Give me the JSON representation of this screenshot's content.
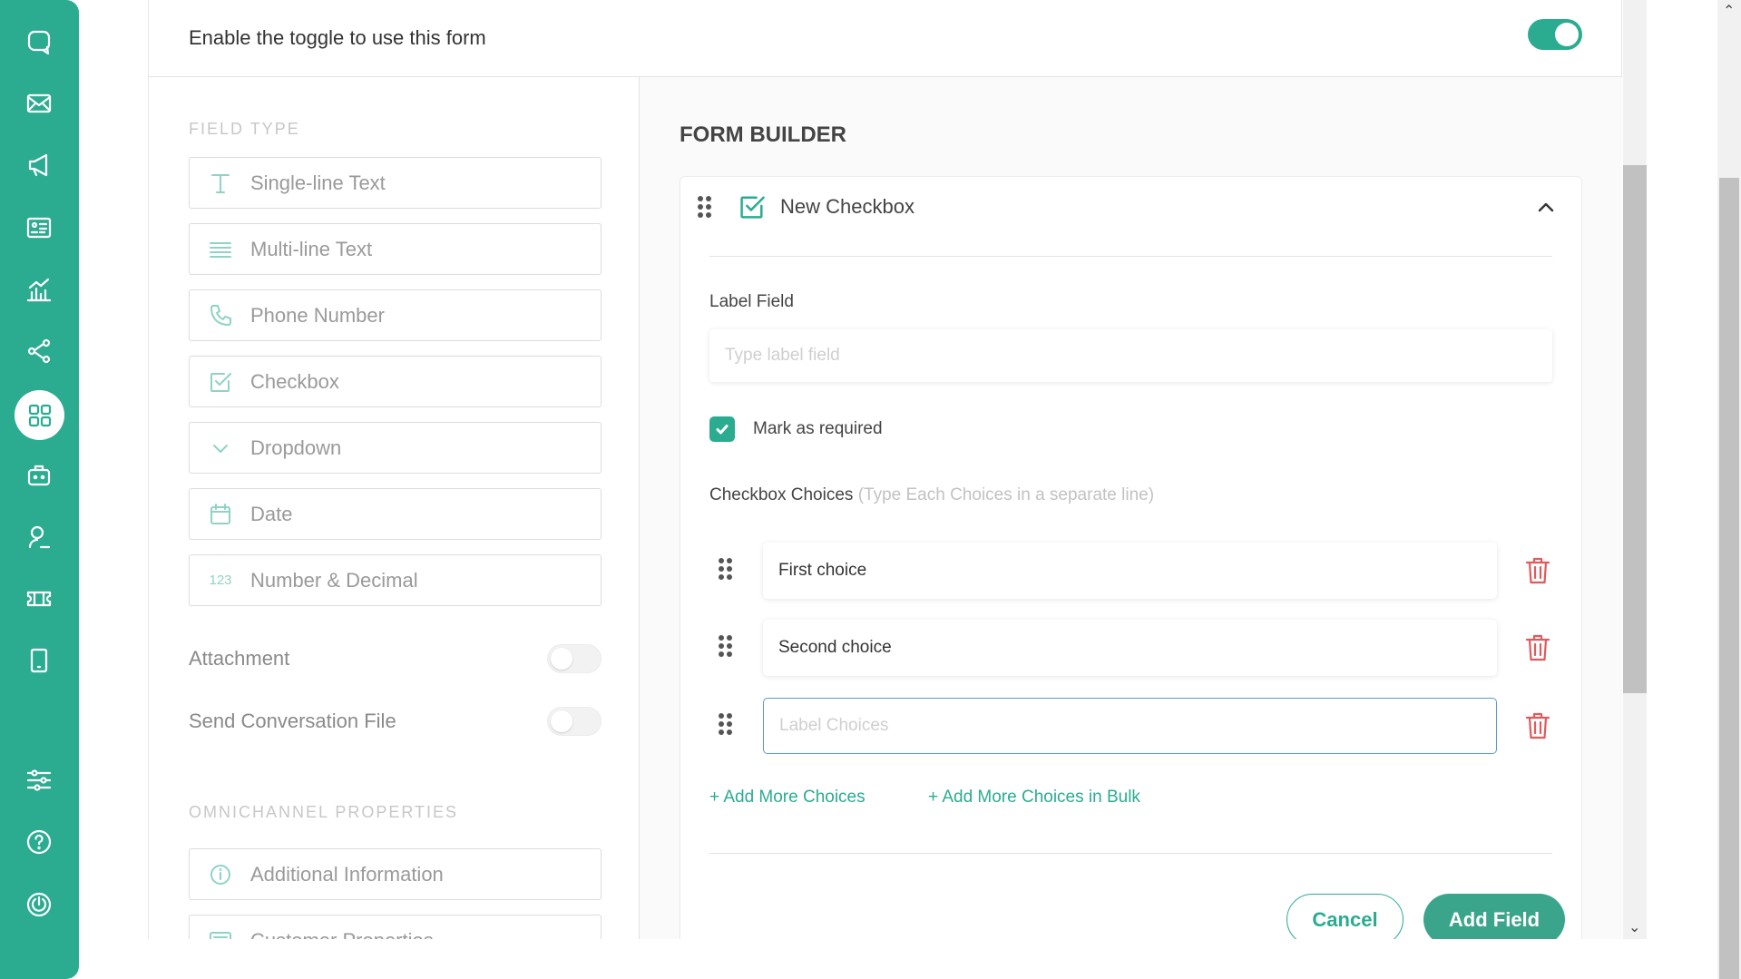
{
  "header": {
    "enable_text": "Enable the toggle to use this form",
    "toggle_on": true
  },
  "field_type": {
    "section_label": "FIELD TYPE",
    "items": [
      {
        "label": "Single-line Text",
        "icon": "text-t-icon"
      },
      {
        "label": "Multi-line Text",
        "icon": "lines-icon"
      },
      {
        "label": "Phone Number",
        "icon": "phone-icon"
      },
      {
        "label": "Checkbox",
        "icon": "checkbox-icon"
      },
      {
        "label": "Dropdown",
        "icon": "chevron-down-icon"
      },
      {
        "label": "Date",
        "icon": "calendar-icon"
      },
      {
        "label": "Number & Decimal",
        "icon": "number-icon",
        "icon_text": "123"
      }
    ],
    "toggles": [
      {
        "label": "Attachment",
        "on": false
      },
      {
        "label": "Send Conversation File",
        "on": false
      }
    ]
  },
  "omnichannel": {
    "section_label": "OMNICHANNEL PROPERTIES",
    "items": [
      {
        "label": "Additional Information",
        "icon": "info-icon"
      },
      {
        "label": "Customer Properties",
        "icon": "card-icon"
      }
    ]
  },
  "form_builder": {
    "title": "FORM BUILDER",
    "card": {
      "title": "New Checkbox",
      "label_field_label": "Label Field",
      "label_field_placeholder": "Type label field",
      "label_field_value": "",
      "required_label": "Mark as required",
      "required_checked": true,
      "choices_label": "Checkbox Choices",
      "choices_hint": "(Type Each Choices in a separate line)",
      "choices": [
        {
          "value": "First choice",
          "placeholder": ""
        },
        {
          "value": "Second choice",
          "placeholder": ""
        },
        {
          "value": "",
          "placeholder": "Label Choices"
        }
      ],
      "add_more_label": "+ Add More Choices",
      "add_bulk_label": "+ Add More Choices in Bulk",
      "cancel_label": "Cancel",
      "add_field_label": "Add Field"
    }
  },
  "sidebar": {
    "items": [
      {
        "icon": "chat-icon"
      },
      {
        "icon": "mail-icon"
      },
      {
        "icon": "megaphone-icon"
      },
      {
        "icon": "contact-card-icon"
      },
      {
        "icon": "analytics-icon"
      },
      {
        "icon": "share-nodes-icon"
      },
      {
        "icon": "apps-grid-icon",
        "active": true
      },
      {
        "icon": "bot-icon"
      },
      {
        "icon": "agent-icon"
      },
      {
        "icon": "ticket-icon"
      },
      {
        "icon": "mobile-icon"
      },
      {
        "icon": "sliders-icon"
      },
      {
        "icon": "help-icon"
      },
      {
        "icon": "power-icon"
      }
    ]
  },
  "colors": {
    "brand": "#2bac91",
    "delete": "#e05b5b",
    "focus": "#5b9bd5"
  }
}
